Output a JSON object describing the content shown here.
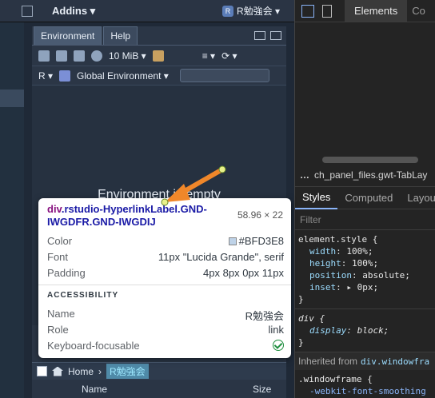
{
  "rstudio": {
    "topbar": {
      "addins_label": "Addins ▾",
      "project_label": "R勉強会 ▾",
      "project_badge": "R"
    },
    "panel": {
      "tabs": [
        {
          "label": "Environment",
          "active": true
        },
        {
          "label": "Help",
          "active": false
        }
      ],
      "memory_label": "10 MiB ▾",
      "lang_label": "R ▾",
      "env_select": "Global Environment ▾",
      "empty_message": "Environment is empty"
    },
    "files": {
      "home_label": "Home",
      "crumb_selected": "R勉強会",
      "col_name": "Name",
      "col_size": "Size"
    }
  },
  "tooltip": {
    "selector_tag": "div",
    "selector_rest": ".rstudio-HyperlinkLabel.GND-IWGDFR.GND-IWGDIJ",
    "dims": "58.96 × 22",
    "rows": [
      {
        "key": "Color",
        "value": "#BFD3E8"
      },
      {
        "key": "Font",
        "value": "11px \"Lucida Grande\", serif"
      },
      {
        "key": "Padding",
        "value": "4px 8px 0px 11px"
      }
    ],
    "accessibility_heading": "ACCESSIBILITY",
    "acc_rows": [
      {
        "key": "Name",
        "value": "R勉強会"
      },
      {
        "key": "Role",
        "value": "link"
      },
      {
        "key": "Keyboard-focusable",
        "value": ""
      }
    ],
    "swatch_color": "#BFD3E8"
  },
  "devtools": {
    "tabs": [
      "Elements",
      "Co"
    ],
    "breadcrumb_prefix": "…",
    "breadcrumb": "ch_panel_files.gwt-TabLay",
    "subtabs": [
      "Styles",
      "Computed",
      "Layou"
    ],
    "filter_placeholder": "Filter",
    "element_style": {
      "selector": "element.style {",
      "props": [
        {
          "name": "width",
          "value": "100%;"
        },
        {
          "name": "height",
          "value": "100%;"
        },
        {
          "name": "position",
          "value": "absolute;"
        },
        {
          "name": "inset",
          "value": "▸ 0px;"
        }
      ],
      "close": "}"
    },
    "div_rule": {
      "selector": "div {",
      "prop": "display",
      "value": "block;",
      "close": "}"
    },
    "inherited_label": "Inherited from",
    "inherited_from": "div.windowfra",
    "windowframe": {
      "selector": ".windowframe {",
      "prop": "-webkit-font-smoothing"
    }
  }
}
